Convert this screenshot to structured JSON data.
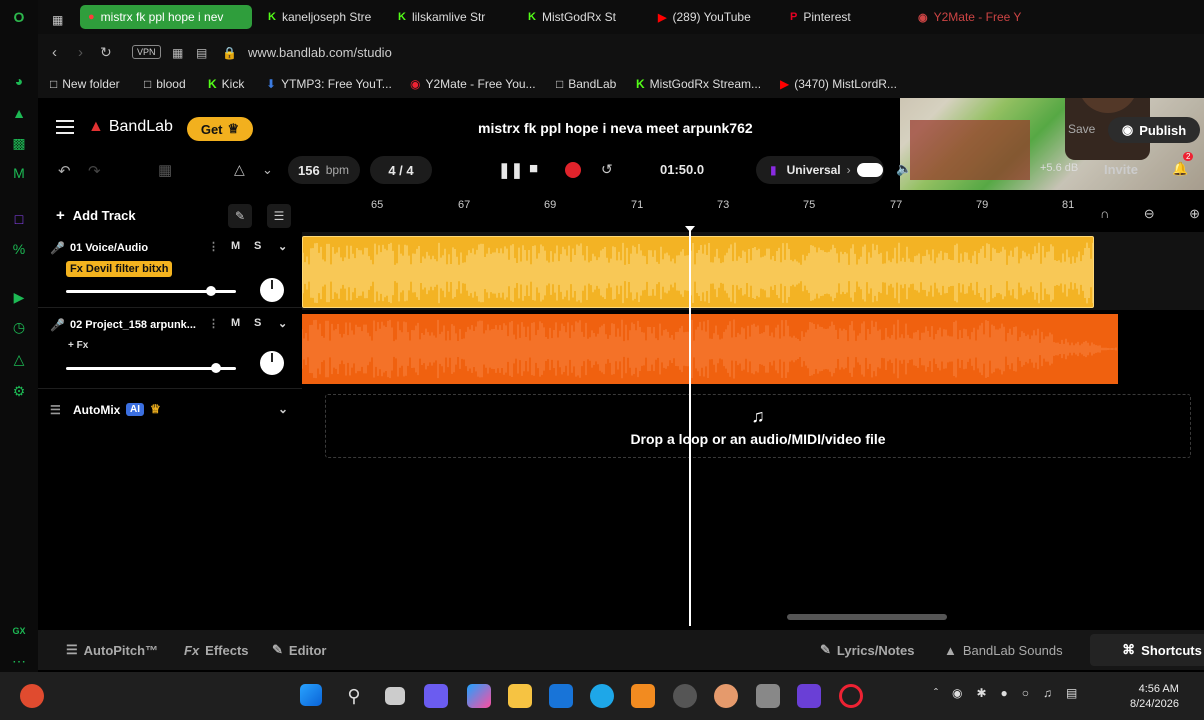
{
  "browser": {
    "tabs": [
      {
        "label": "mistrx fk ppl hope i nev",
        "icon": "K",
        "active": true
      },
      {
        "label": "kaneljoseph Stre",
        "icon": "K"
      },
      {
        "label": "lilskamlive Str",
        "icon": "K"
      },
      {
        "label": "MistGodRx St",
        "icon": "K"
      },
      {
        "label": "(289) YouTube",
        "icon": "youtube-icon"
      },
      {
        "label": "Pinterest",
        "icon": "pinterest-icon"
      },
      {
        "label": "Y2Mate - Free Y",
        "icon": "y2mate-icon"
      }
    ],
    "vpn": "VPN",
    "url": "www.bandlab.com/studio",
    "bookmarks": [
      "New folder",
      "blood",
      "Kick",
      "YTMP3: Free YouT...",
      "Y2Mate - Free You...",
      "BandLab",
      "MistGodRx Stream...",
      "(3470) MistLordR..."
    ]
  },
  "app": {
    "brand": "BandLab",
    "get_label": "Get",
    "project_title": "mistrx fk ppl hope i neva meet arpunk762",
    "save_label": "Save",
    "publish_label": "Publish",
    "invite_label": "Invite",
    "notification_count": "2",
    "tempo": "156",
    "tempo_unit": "bpm",
    "time_signature": "4 / 4",
    "time": "01:50.0",
    "key": "Universal",
    "gain": "+5.6 dB"
  },
  "ruler": {
    "ticks": [
      "65",
      "67",
      "69",
      "71",
      "73",
      "75",
      "77",
      "79",
      "81"
    ]
  },
  "tracks": [
    {
      "name": "01  Voice/Audio",
      "fx": "Fx Devil filter bitxh",
      "mute": "M",
      "solo": "S",
      "volume": 0.85,
      "color": "#f3b324"
    },
    {
      "name": "02  Project_158 arpunk...",
      "fx": "+ Fx",
      "mute": "M",
      "solo": "S",
      "volume": 0.88,
      "color": "#f0610f"
    }
  ],
  "add_track_label": "Add Track",
  "automix": {
    "label": "AutoMix",
    "badge": "AI"
  },
  "drop_zone": "Drop a loop or an audio/MIDI/video file",
  "bottom_bar": {
    "autopitch": "AutoPitch™",
    "effects": "Effects",
    "editor": "Editor",
    "lyrics": "Lyrics/Notes",
    "sounds": "BandLab Sounds",
    "shortcuts": "Shortcuts"
  },
  "taskbar": {
    "time": "4:56 AM",
    "date": "8/24/2026"
  }
}
